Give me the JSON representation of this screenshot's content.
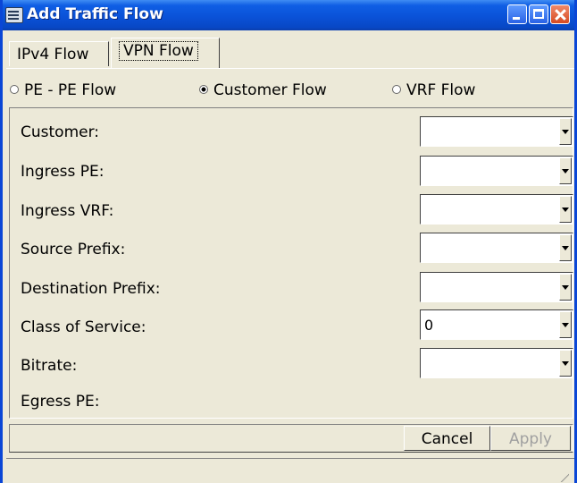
{
  "window": {
    "title": "Add Traffic Flow"
  },
  "tabs": [
    {
      "label": "IPv4 Flow",
      "selected": false
    },
    {
      "label": "VPN Flow",
      "selected": true
    }
  ],
  "flow_type": {
    "options": [
      {
        "label": "PE - PE Flow",
        "selected": false
      },
      {
        "label": "Customer Flow",
        "selected": true
      },
      {
        "label": "VRF Flow",
        "selected": false
      }
    ]
  },
  "form": {
    "fields": [
      {
        "label": "Customer:",
        "value": ""
      },
      {
        "label": "Ingress PE:",
        "value": ""
      },
      {
        "label": "Ingress VRF:",
        "value": ""
      },
      {
        "label": "Source Prefix:",
        "value": ""
      },
      {
        "label": "Destination Prefix:",
        "value": ""
      },
      {
        "label": "Class of Service:",
        "value": "0"
      },
      {
        "label": "Bitrate:",
        "value": ""
      }
    ],
    "egress_label": "Egress PE:"
  },
  "buttons": {
    "cancel": "Cancel",
    "apply": "Apply",
    "apply_enabled": false
  },
  "colors": {
    "title_bar": "#0a52d8",
    "window_bg": "#ece9d8",
    "disabled_text": "#a0a0a0"
  },
  "icons": [
    "app-icon",
    "minimize-icon",
    "maximize-icon",
    "close-icon",
    "radio-icon",
    "dropdown-arrow-icon",
    "resize-grip-icon"
  ]
}
